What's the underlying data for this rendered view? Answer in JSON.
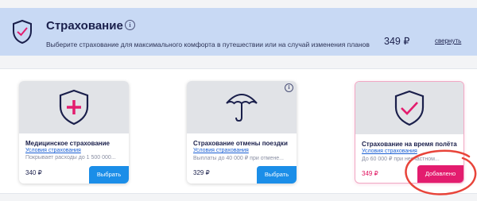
{
  "header": {
    "title": "Страхование",
    "info_symbol": "i",
    "subtitle": "Выберите страхование для максимального комфорта в путешествии или на случай изменения планов",
    "price": "349 ₽",
    "collapse_label": "свернуть"
  },
  "cards": [
    {
      "name": "Медицинское страхование",
      "terms": "Условия страхования",
      "desc": "Покрывает расходы до 1 500 000...",
      "price": "340 ₽",
      "button": "Выбрать",
      "icon": "medical-shield-icon",
      "state": "available"
    },
    {
      "name": "Страхование отмены поездки",
      "terms": "Условия страхования",
      "desc": "Выплаты до 40 000 ₽ при отмене...",
      "price": "329 ₽",
      "button": "Выбрать",
      "icon": "umbrella-icon",
      "state": "available",
      "info_symbol": "i"
    },
    {
      "name": "Страхование на время полёта",
      "terms": "Условия страхования",
      "desc": "До 60 000 ₽ при несчастном...",
      "price": "349 ₽",
      "button": "Добавлено",
      "icon": "checkmark-shield-icon",
      "state": "added"
    }
  ],
  "colors": {
    "header_bg": "#c8d9f4",
    "accent_pink": "#e31c6e",
    "button_blue": "#1b8ee8",
    "annotation_red": "#e8443a",
    "text_dark": "#1a1f4b"
  }
}
